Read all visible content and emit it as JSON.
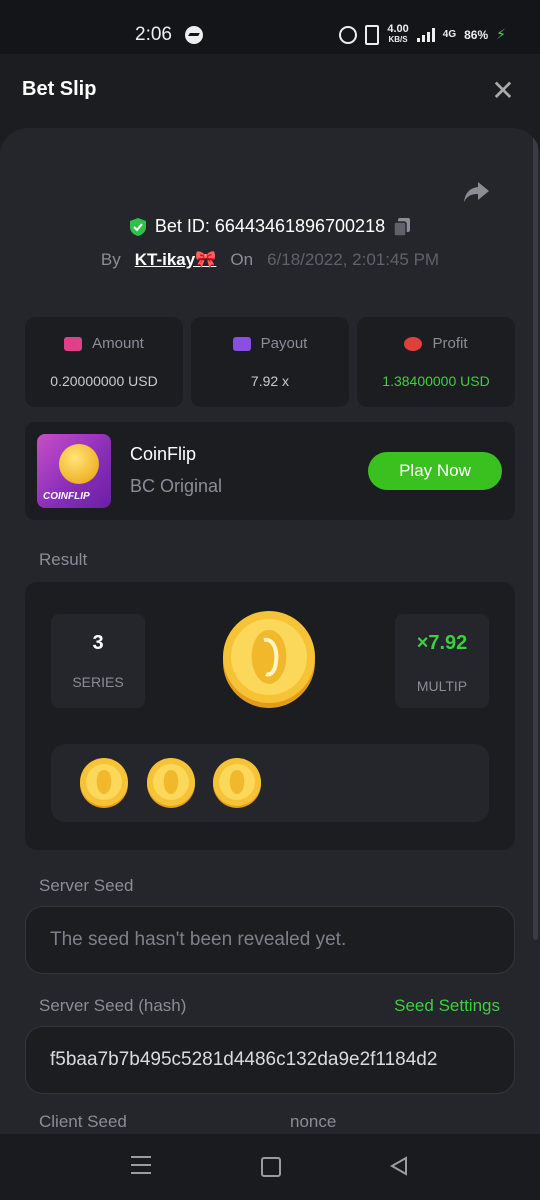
{
  "status_bar": {
    "time": "2:06",
    "speed_top": "4.00",
    "speed_unit": "KB/S",
    "network": "4G",
    "battery": "86%"
  },
  "header": {
    "title": "Bet Slip"
  },
  "bet": {
    "id_label": "Bet ID: 66443461896700218",
    "by_label": "By",
    "user": "KT-ikay🎀",
    "on_label": "On",
    "date": "6/18/2022, 2:01:45 PM"
  },
  "stats": [
    {
      "label": "Amount",
      "value": "0.20000000 USD",
      "icon_color": "#e0408a"
    },
    {
      "label": "Payout",
      "value": "7.92 x",
      "icon_color": "#8a4fe0"
    },
    {
      "label": "Profit",
      "value": "1.38400000 USD",
      "icon_color": "#e0403a"
    }
  ],
  "game": {
    "thumb_label": "COINFLIP",
    "name": "CoinFlip",
    "subtitle": "BC Original",
    "play_label": "Play Now"
  },
  "result": {
    "label": "Result",
    "series_value": "3",
    "series_label": "SERIES",
    "multiplier_value": "×7.92",
    "multiplier_label": "MULTIP",
    "coin_count": 3
  },
  "server_seed": {
    "label": "Server Seed",
    "placeholder": "The seed hasn't been revealed yet."
  },
  "server_seed_hash": {
    "label": "Server Seed (hash)",
    "settings_link": "Seed Settings",
    "value": "f5baa7b7b495c5281d4486c132da9e2f1184d2"
  },
  "footer_labels": {
    "client_seed": "Client Seed",
    "nonce": "nonce"
  },
  "colors": {
    "accent_green": "#3bc11f",
    "background": "#1c1d21",
    "panel": "#24262b"
  }
}
